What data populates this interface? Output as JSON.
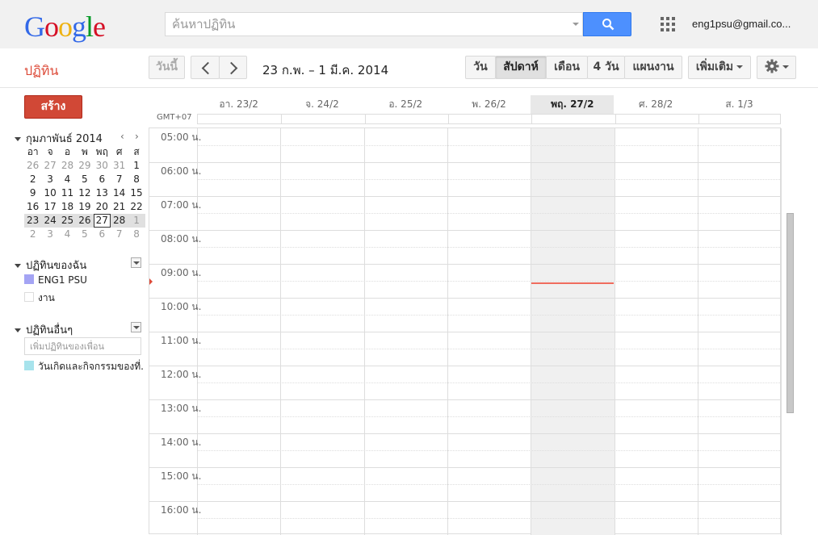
{
  "header": {
    "logo_letters": [
      {
        "ch": "G",
        "color": "#3369e8"
      },
      {
        "ch": "o",
        "color": "#d50f25"
      },
      {
        "ch": "o",
        "color": "#eeb211"
      },
      {
        "ch": "g",
        "color": "#3369e8"
      },
      {
        "ch": "l",
        "color": "#009925"
      },
      {
        "ch": "e",
        "color": "#d50f25"
      }
    ],
    "search_placeholder": "ค้นหาปฏิทิน",
    "search_icon": "search-icon",
    "apps_icon": "apps-grid-icon",
    "account": "eng1psu@gmail.co..."
  },
  "toolbar": {
    "app_name": "ปฏิทิน",
    "today_label": "วันนี้",
    "prev_icon": "chevron-left-icon",
    "next_icon": "chevron-right-icon",
    "date_range": "23 ก.พ. – 1 มี.ค. 2014",
    "views": [
      {
        "label": "วัน",
        "active": false
      },
      {
        "label": "สัปดาห์",
        "active": true
      },
      {
        "label": "เดือน",
        "active": false
      },
      {
        "label": "4 วัน",
        "active": false
      },
      {
        "label": "แผนงาน",
        "active": false
      }
    ],
    "more_label": "เพิ่มเติม",
    "settings_icon": "gear-icon"
  },
  "sidebar": {
    "create_label": "สร้าง",
    "mini_title": "กุมภาพันธ์ 2014",
    "mini_prev": "‹",
    "mini_next": "›",
    "weekdays": [
      "อา",
      "จ",
      "อ",
      "พ",
      "พฤ",
      "ศ",
      "ส"
    ],
    "weeks": [
      [
        "26",
        "27",
        "28",
        "29",
        "30",
        "31",
        "1"
      ],
      [
        "2",
        "3",
        "4",
        "5",
        "6",
        "7",
        "8"
      ],
      [
        "9",
        "10",
        "11",
        "12",
        "13",
        "14",
        "15"
      ],
      [
        "16",
        "17",
        "18",
        "19",
        "20",
        "21",
        "22"
      ],
      [
        "23",
        "24",
        "25",
        "26",
        "27",
        "28",
        "1"
      ],
      [
        "2",
        "3",
        "4",
        "5",
        "6",
        "7",
        "8"
      ]
    ],
    "highlight_week": 4,
    "today_cell": [
      4,
      4
    ],
    "my_calendars_title": "ปฏิทินของฉัน",
    "my_calendars": [
      {
        "label": "ENG1 PSU",
        "color": "#a4a4f4"
      },
      {
        "label": "งาน",
        "color": "#ffffff"
      }
    ],
    "other_calendars_title": "ปฏิทินอื่นๆ",
    "friend_placeholder": "เพิ่มปฏิทินของเพื่อน",
    "other_calendars": [
      {
        "label": "วันเกิดและกิจกรรมของที่...",
        "color": "#a7e3ec"
      }
    ]
  },
  "calendar": {
    "timezone": "GMT+07",
    "days": [
      {
        "label": "อา. 23/2",
        "today": false
      },
      {
        "label": "จ. 24/2",
        "today": false
      },
      {
        "label": "อ. 25/2",
        "today": false
      },
      {
        "label": "พ. 26/2",
        "today": false
      },
      {
        "label": "พฤ. 27/2",
        "today": true
      },
      {
        "label": "ศ. 28/2",
        "today": false
      },
      {
        "label": "ส. 1/3",
        "today": false
      }
    ],
    "hours": [
      "05:00 น.",
      "06:00 น.",
      "07:00 น.",
      "08:00 น.",
      "09:00 น.",
      "10:00 น.",
      "11:00 น.",
      "12:00 น.",
      "13:00 น.",
      "14:00 น.",
      "15:00 น.",
      "16:00 น."
    ],
    "current_time_indicator_color": "#ef6c5e"
  }
}
